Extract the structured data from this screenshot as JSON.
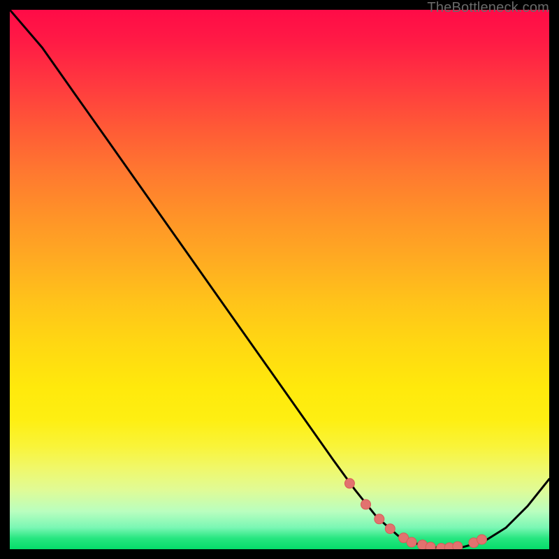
{
  "credit": "TheBottleneck.com",
  "colors": {
    "page_bg": "#000000",
    "curve": "#000000",
    "marker_fill": "#e2726f",
    "marker_stroke": "#d95b57"
  },
  "chart_data": {
    "type": "line",
    "title": "",
    "xlabel": "",
    "ylabel": "",
    "xlim": [
      0,
      100
    ],
    "ylim": [
      0,
      100
    ],
    "series": [
      {
        "name": "bottleneck-curve",
        "x": [
          0,
          6,
          12,
          18,
          24,
          30,
          36,
          42,
          48,
          54,
          60,
          64,
          68,
          72,
          76,
          80,
          84,
          88,
          92,
          96,
          100
        ],
        "values": [
          100,
          93,
          84.5,
          76,
          67.5,
          59,
          50.5,
          42,
          33.5,
          25,
          16.5,
          11,
          6,
          2.5,
          0.8,
          0.2,
          0.4,
          1.5,
          4,
          8,
          13
        ]
      }
    ],
    "markers": {
      "name": "highlighted-points",
      "x": [
        63,
        66,
        68.5,
        70.5,
        73,
        74.5,
        76.5,
        78,
        80,
        81.5,
        83,
        86,
        87.5
      ],
      "values": [
        12.2,
        8.3,
        5.6,
        3.8,
        2.1,
        1.3,
        0.8,
        0.4,
        0.2,
        0.3,
        0.5,
        1.2,
        1.8
      ]
    }
  }
}
